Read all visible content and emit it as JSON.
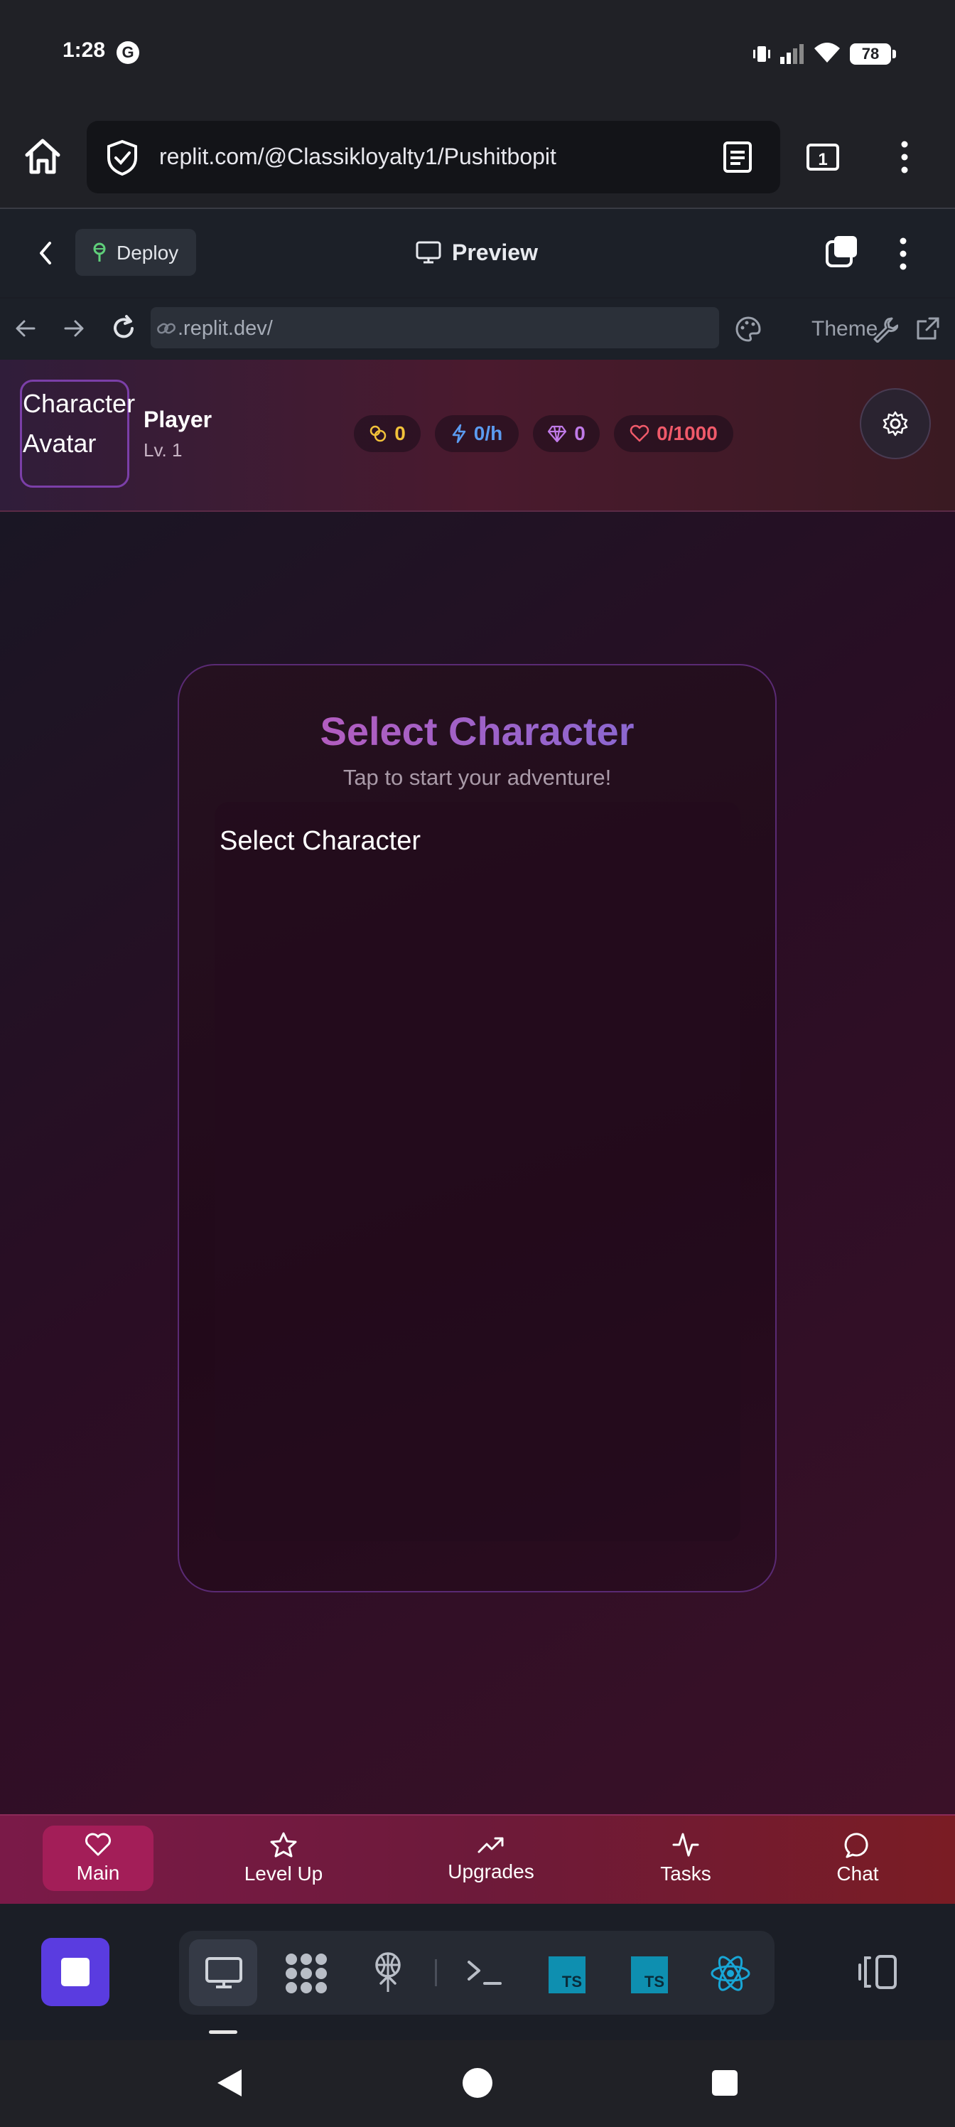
{
  "status_bar": {
    "time": "1:28",
    "carrier_badge": "G",
    "battery": "78"
  },
  "browser": {
    "url": "replit.com/@Classikloyalty1/Pushitbopit",
    "tab_count": "1"
  },
  "replit_toolbar": {
    "deploy_label": "Deploy",
    "preview_label": "Preview"
  },
  "replit_nav": {
    "address": ".replit.dev/",
    "theme_label": "Theme"
  },
  "game_header": {
    "avatar_text": "Character Avatar",
    "player_name": "Player",
    "player_level": "Lv. 1",
    "stats": [
      {
        "name": "coins",
        "value": "0",
        "color": "#f2c23a",
        "icon": "coins-icon"
      },
      {
        "name": "energy-rate",
        "value": "0/h",
        "color": "#5b9bf0",
        "icon": "lightning-icon"
      },
      {
        "name": "gems",
        "value": "0",
        "color": "#c07ae8",
        "icon": "gem-icon"
      },
      {
        "name": "health",
        "value": "0/1000",
        "color": "#f05a6a",
        "icon": "heart-icon"
      }
    ]
  },
  "card": {
    "title": "Select Character",
    "subtitle": "Tap to start your adventure!",
    "label": "Select Character"
  },
  "bottom_nav": [
    {
      "label": "Main",
      "icon": "heart-icon",
      "active": true
    },
    {
      "label": "Level Up",
      "icon": "star-icon",
      "active": false
    },
    {
      "label": "Upgrades",
      "icon": "trending-up-icon",
      "active": false
    },
    {
      "label": "Tasks",
      "icon": "activity-icon",
      "active": false
    },
    {
      "label": "Chat",
      "icon": "chat-bubble-icon",
      "active": false
    }
  ],
  "dev_tools": {
    "ts_label_1": "TS",
    "ts_label_2": "TS"
  }
}
